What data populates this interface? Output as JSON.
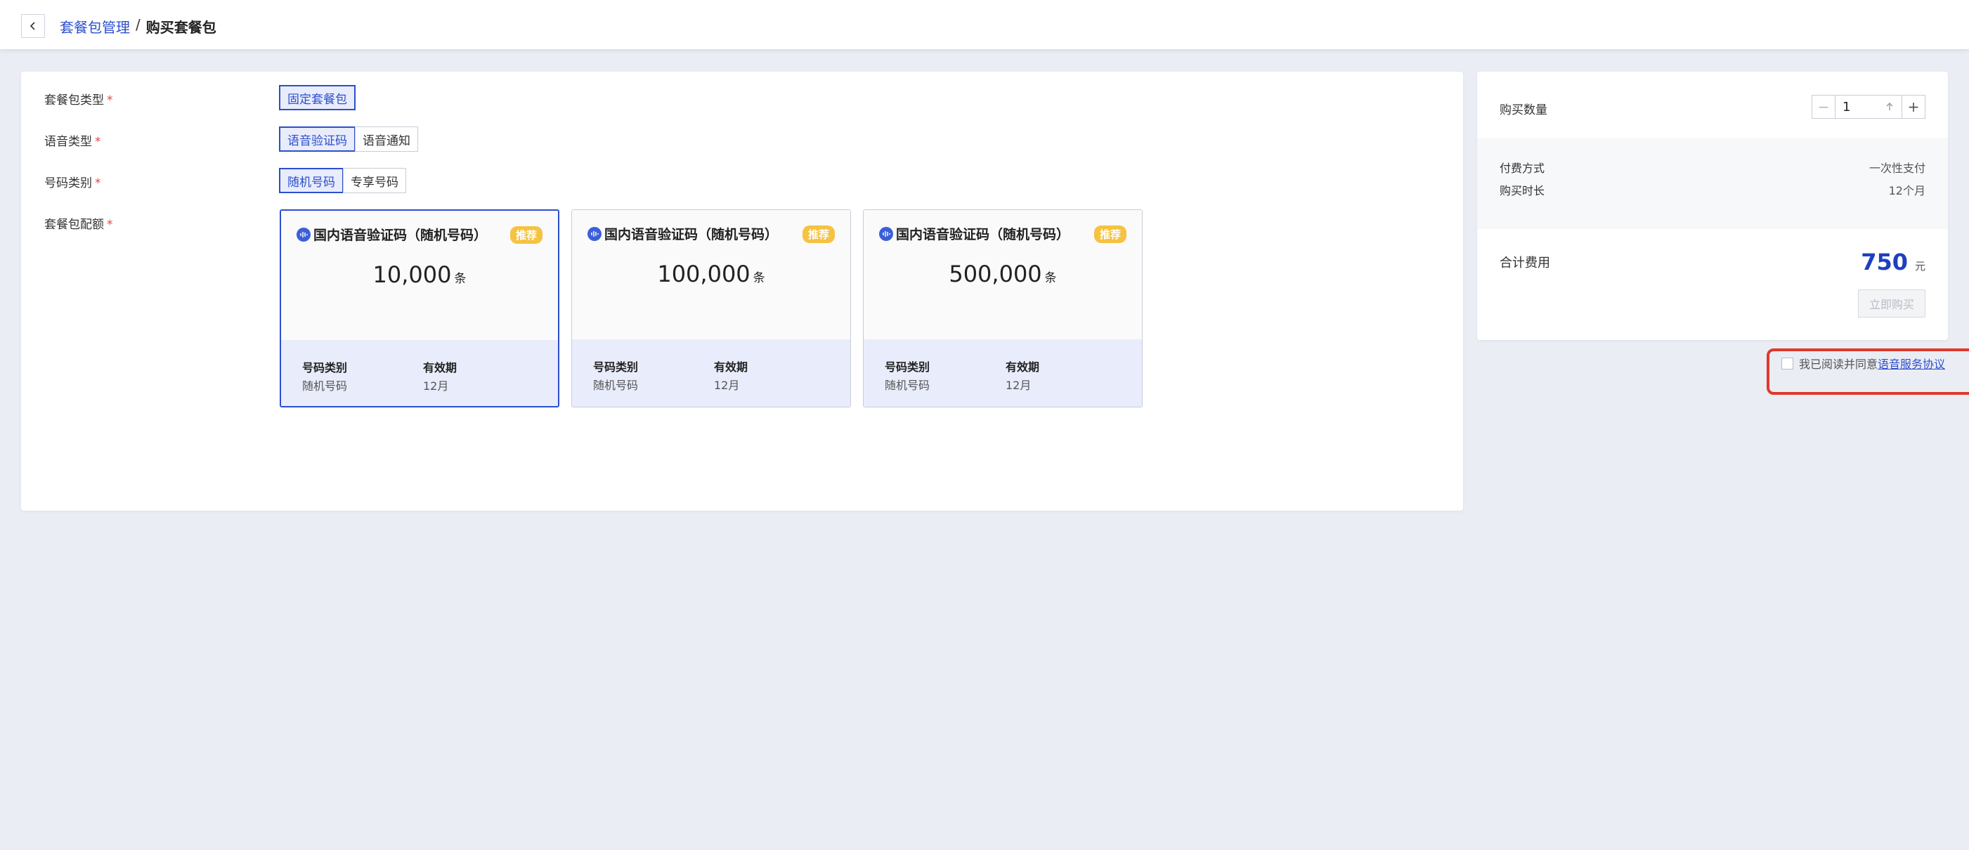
{
  "breadcrumb": {
    "parent": "套餐包管理",
    "separator": "/",
    "current": "购买套餐包"
  },
  "form": {
    "package_type": {
      "label": "套餐包类型",
      "options": [
        "固定套餐包"
      ],
      "selected": "固定套餐包"
    },
    "voice_type": {
      "label": "语音类型",
      "options": [
        "语音验证码",
        "语音通知"
      ],
      "selected": "语音验证码"
    },
    "number_type": {
      "label": "号码类别",
      "options": [
        "随机号码",
        "专享号码"
      ],
      "selected": "随机号码"
    },
    "quota": {
      "label": "套餐包配额"
    },
    "required_mark": "*"
  },
  "packages": [
    {
      "title": "国内语音验证码（随机号码）",
      "badge": "推荐",
      "quantity": "10,000",
      "unit": "条",
      "k1": "号码类别",
      "v1": "随机号码",
      "k2": "有效期",
      "v2": "12月",
      "selected": true
    },
    {
      "title": "国内语音验证码（随机号码）",
      "badge": "推荐",
      "quantity": "100,000",
      "unit": "条",
      "k1": "号码类别",
      "v1": "随机号码",
      "k2": "有效期",
      "v2": "12月",
      "selected": false
    },
    {
      "title": "国内语音验证码（随机号码）",
      "badge": "推荐",
      "quantity": "500,000",
      "unit": "条",
      "k1": "号码类别",
      "v1": "随机号码",
      "k2": "有效期",
      "v2": "12月",
      "selected": false
    }
  ],
  "order": {
    "qty_label": "购买数量",
    "qty_value": "1",
    "minus": "−",
    "plus": "+",
    "payment_label": "付费方式",
    "payment_value": "一次性支付",
    "duration_label": "购买时长",
    "duration_value": "12个月",
    "total_label": "合计费用",
    "total_value": "750",
    "currency": "元",
    "buy_button": "立即购买"
  },
  "agreement": {
    "text": "我已阅读并同意",
    "link": "语音服务协议",
    "checked": false
  },
  "colors": {
    "accent": "#2c4fcc",
    "badge": "#f5c242",
    "highlight_border": "#e0392b"
  }
}
